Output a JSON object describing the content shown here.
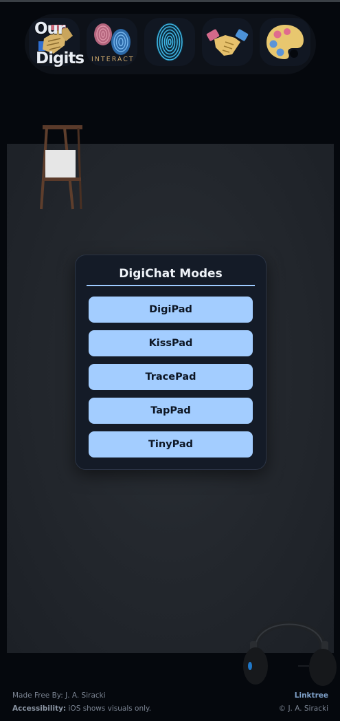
{
  "nav": {
    "logo_line1": "Our",
    "logo_line2": "Digits",
    "interact_label": "INTERACT",
    "items": [
      {
        "name": "our-digits-logo"
      },
      {
        "name": "interact"
      },
      {
        "name": "fingerprint"
      },
      {
        "name": "handshake"
      },
      {
        "name": "palette"
      }
    ]
  },
  "modal": {
    "title": "DigiChat Modes",
    "modes": [
      "DigiPad",
      "KissPad",
      "TracePad",
      "TapPad",
      "TinyPad"
    ]
  },
  "footer": {
    "made_by": "Made Free By: J. A. Siracki",
    "accessibility_label": "Accessibility:",
    "accessibility_text": " iOS shows visuals only.",
    "link_label": "Linktree",
    "copyright": "© J. A. Siracki"
  },
  "colors": {
    "background": "#05080d",
    "stage": "#23272d",
    "modal": "#141b27",
    "button": "#a3cdff",
    "accent_rule": "#9ecbff"
  }
}
